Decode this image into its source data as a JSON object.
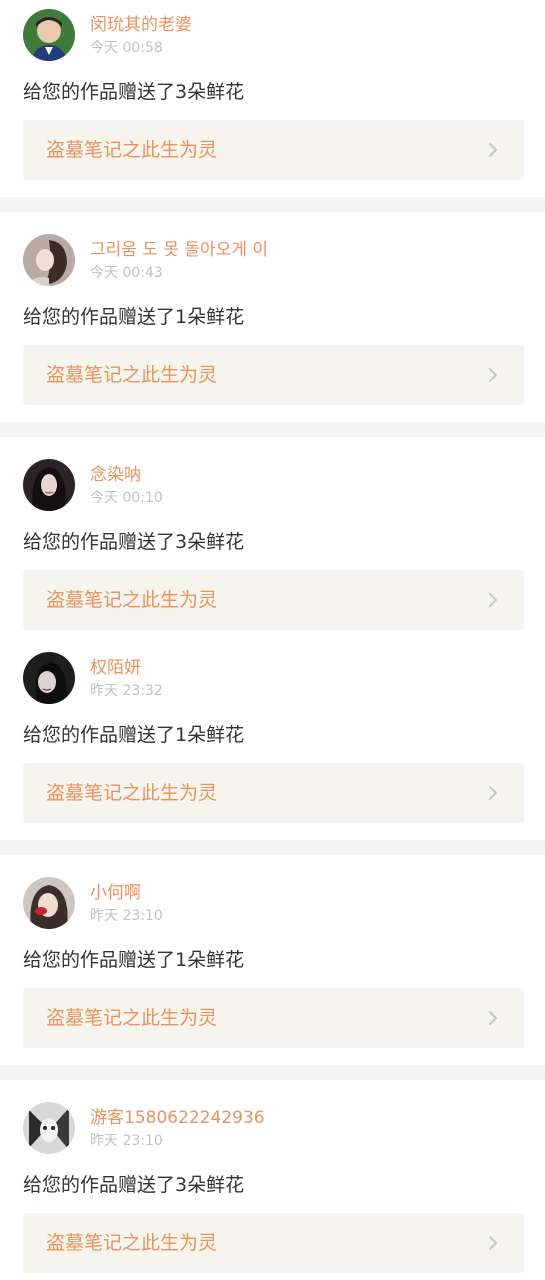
{
  "notifications": [
    {
      "avatar": "avatar-boy-photo",
      "username": "闵玧其的老婆",
      "time": "今天 00:58",
      "message": "给您的作品赠送了3朵鲜花",
      "work_title": "盗墓笔记之此生为灵"
    },
    {
      "avatar": "avatar-girl-side-photo",
      "username": "그리움 도 못 돌아오게 이",
      "time": "今天 00:43",
      "message": "给您的作品赠送了1朵鲜花",
      "work_title": "盗墓笔记之此生为灵"
    },
    {
      "avatar": "avatar-girl-dark-hair-photo",
      "username": "念染呐",
      "time": "今天 00:10",
      "message": "给您的作品赠送了3朵鲜花",
      "work_title": "盗墓笔记之此生为灵"
    },
    {
      "avatar": "avatar-girl-bw-photo",
      "username": "权陌妍",
      "time": "昨天 23:32",
      "message": "给您的作品赠送了1朵鲜花",
      "work_title": "盗墓笔记之此生为灵"
    },
    {
      "avatar": "avatar-girl-red-lips-photo",
      "username": "小何啊",
      "time": "昨天 23:10",
      "message": "给您的作品赠送了1朵鲜花",
      "work_title": "盗墓笔记之此生为灵"
    },
    {
      "avatar": "avatar-guest-mask-photo",
      "username": "游客1580622242936",
      "time": "昨天 23:10",
      "message": "给您的作品赠送了3朵鲜花",
      "work_title": "盗墓笔记之此生为灵"
    }
  ],
  "colors": {
    "accent": "#e8935e",
    "time": "#c2c2c2",
    "text": "#333333",
    "work_bg": "#f5f5ee",
    "separator": "#f5f5f5"
  }
}
